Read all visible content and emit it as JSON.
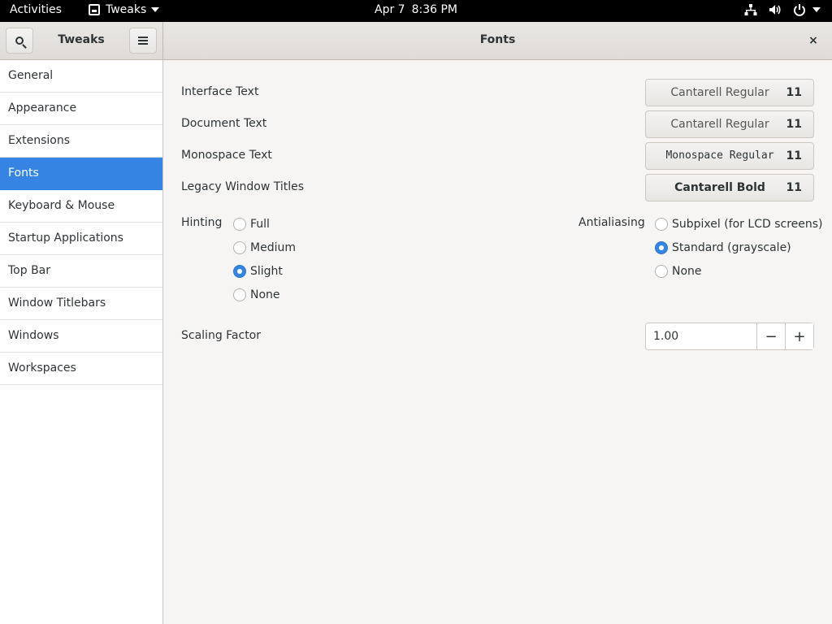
{
  "topbar": {
    "activities": "Activities",
    "app_name": "Tweaks",
    "date": "Apr 7",
    "time": "8:36 PM"
  },
  "header": {
    "left_title": "Tweaks",
    "title": "Fonts"
  },
  "sidebar": {
    "items": [
      {
        "label": "General"
      },
      {
        "label": "Appearance"
      },
      {
        "label": "Extensions"
      },
      {
        "label": "Fonts",
        "active": true
      },
      {
        "label": "Keyboard & Mouse"
      },
      {
        "label": "Startup Applications"
      },
      {
        "label": "Top Bar"
      },
      {
        "label": "Window Titlebars"
      },
      {
        "label": "Windows"
      },
      {
        "label": "Workspaces"
      }
    ]
  },
  "fonts": {
    "interface": {
      "label": "Interface Text",
      "font": "Cantarell Regular",
      "size": "11"
    },
    "document": {
      "label": "Document Text",
      "font": "Cantarell Regular",
      "size": "11"
    },
    "monospace": {
      "label": "Monospace Text",
      "font": "Monospace Regular",
      "size": "11"
    },
    "legacy": {
      "label": "Legacy Window Titles",
      "font": "Cantarell Bold",
      "size": "11"
    }
  },
  "hinting": {
    "label": "Hinting",
    "options": [
      "Full",
      "Medium",
      "Slight",
      "None"
    ],
    "selected": "Slight"
  },
  "antialiasing": {
    "label": "Antialiasing",
    "options": [
      "Subpixel (for LCD screens)",
      "Standard (grayscale)",
      "None"
    ],
    "selected": "Standard (grayscale)"
  },
  "scaling": {
    "label": "Scaling Factor",
    "value": "1.00",
    "minus": "−",
    "plus": "+"
  },
  "icons": {
    "close": "×"
  },
  "colors": {
    "accent": "#3584e4",
    "topbar": "#000000",
    "background": "#f6f5f4"
  }
}
